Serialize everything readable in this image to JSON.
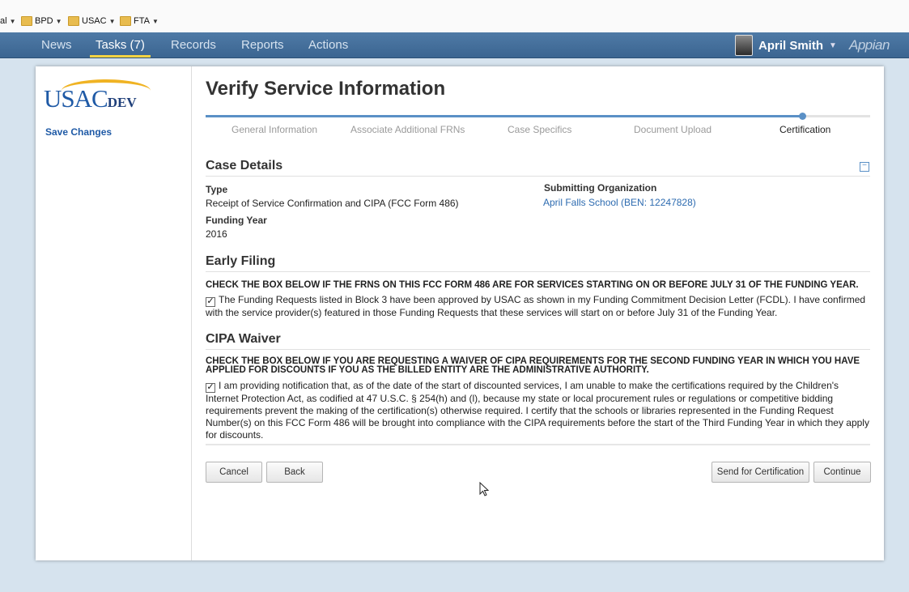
{
  "bookmarks": [
    {
      "label": "al",
      "has_folder": false
    },
    {
      "label": "BPD",
      "has_folder": true
    },
    {
      "label": "USAC",
      "has_folder": true
    },
    {
      "label": "FTA",
      "has_folder": true
    }
  ],
  "nav": {
    "tabs": [
      {
        "label": "News",
        "active": false
      },
      {
        "label": "Tasks (7)",
        "active": true
      },
      {
        "label": "Records",
        "active": false
      },
      {
        "label": "Reports",
        "active": false
      },
      {
        "label": "Actions",
        "active": false
      }
    ],
    "user_name": "April Smith",
    "brand": "Appian"
  },
  "sidebar": {
    "logo_text": "USAC",
    "logo_suffix": "DEV",
    "save_link": "Save Changes"
  },
  "page": {
    "title": "Verify Service Information",
    "steps": [
      {
        "label": "General Information",
        "current": false
      },
      {
        "label": "Associate Additional FRNs",
        "current": false
      },
      {
        "label": "Case Specifics",
        "current": false
      },
      {
        "label": "Document Upload",
        "current": false
      },
      {
        "label": "Certification",
        "current": true
      }
    ]
  },
  "case_details": {
    "title": "Case Details",
    "type_label": "Type",
    "type_value": "Receipt of Service Confirmation and CIPA (FCC Form 486)",
    "year_label": "Funding Year",
    "year_value": "2016",
    "org_label": "Submitting Organization",
    "org_value": "April Falls School (BEN: 12247828)"
  },
  "early_filing": {
    "title": "Early Filing",
    "instruction": "CHECK THE BOX BELOW IF THE FRNS ON THIS FCC FORM 486 ARE FOR SERVICES STARTING ON OR BEFORE JULY 31 OF THE FUNDING YEAR.",
    "checked": true,
    "checkbox_text": "The Funding Requests listed in Block 3 have been approved by USAC as shown in my Funding Commitment Decision Letter (FCDL). I have confirmed with the service provider(s) featured in those Funding Requests that these services will start on or before July 31 of the Funding Year."
  },
  "cipa_waiver": {
    "title": "CIPA Waiver",
    "instruction": "CHECK THE BOX BELOW IF YOU ARE REQUESTING A WAIVER OF CIPA REQUIREMENTS FOR THE SECOND FUNDING YEAR IN WHICH YOU HAVE APPLIED FOR DISCOUNTS IF YOU AS THE BILLED ENTITY ARE THE ADMINISTRATIVE AUTHORITY.",
    "checked": true,
    "checkbox_text": "I am providing notification that, as of the date of the start of discounted services, I am unable to make the certifications required by the Children's Internet Protection Act, as codified at 47 U.S.C. § 254(h) and (l), because my state or local procurement rules or regulations or competitive bidding requirements prevent the making of the certification(s) otherwise required. I certify that the schools or libraries represented in the Funding Request Number(s) on this FCC Form 486 will be brought into compliance with the CIPA requirements before the start of the Third Funding Year in which they apply for discounts."
  },
  "buttons": {
    "cancel": "Cancel",
    "back": "Back",
    "send": "Send for Certification",
    "continue": "Continue"
  },
  "colors": {
    "nav_bg": "#4a74a0",
    "accent": "#5a90c6",
    "active_tab_underline": "#f5d342",
    "link": "#2d6bb0"
  }
}
